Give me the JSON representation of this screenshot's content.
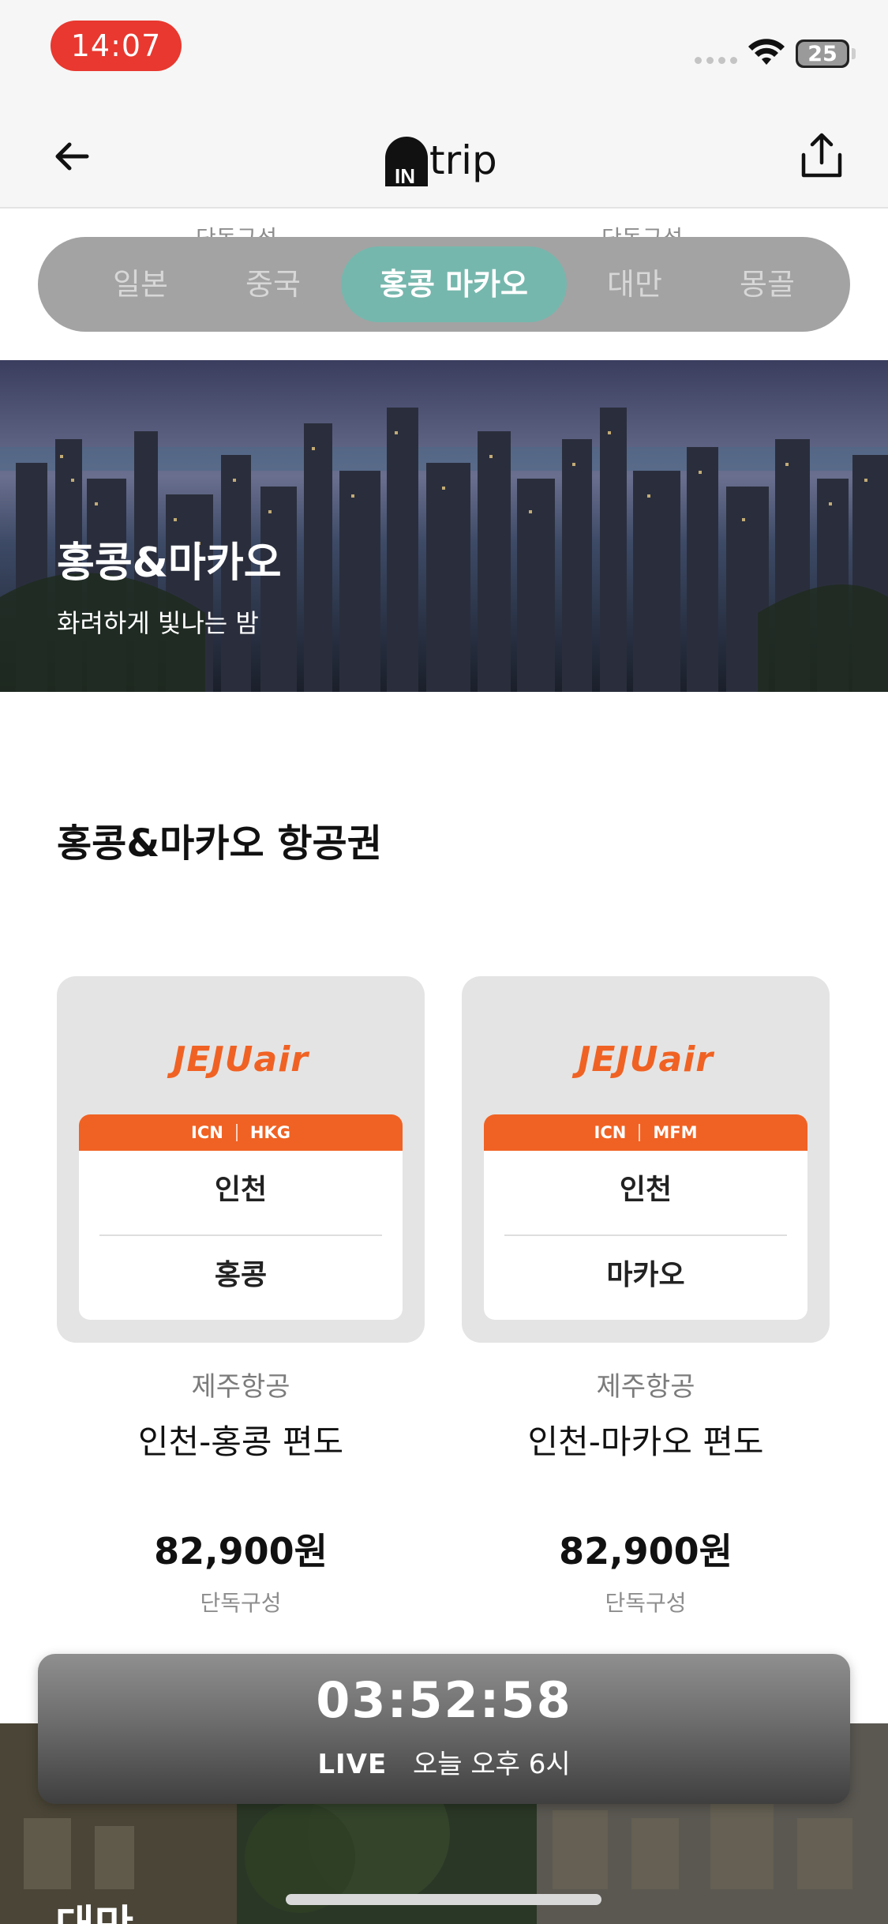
{
  "status_bar": {
    "time": "14:07",
    "battery": "25"
  },
  "header": {
    "logo_mark": "IN",
    "logo_text": "trip"
  },
  "peek_text": [
    "단독구성",
    "단독구성"
  ],
  "tabs": [
    {
      "label": "일본"
    },
    {
      "label": "중국"
    },
    {
      "label": "홍콩 마카오",
      "active": true
    },
    {
      "label": "대만"
    },
    {
      "label": "몽골"
    }
  ],
  "hero": {
    "title": "홍콩&마카오",
    "subtitle": "화려하게 빛나는 밤"
  },
  "section": {
    "title": "홍콩&마카오 항공권"
  },
  "cards": [
    {
      "airline_logo": "JEJUair",
      "from_code": "ICN",
      "to_code": "HKG",
      "from_city": "인천",
      "to_city": "홍콩",
      "airline": "제주항공",
      "route": "인천-홍콩 편도",
      "price": "82,900원",
      "note": "단독구성"
    },
    {
      "airline_logo": "JEJUair",
      "from_code": "ICN",
      "to_code": "MFM",
      "from_city": "인천",
      "to_city": "마카오",
      "airline": "제주항공",
      "route": "인천-마카오 편도",
      "price": "82,900원",
      "note": "단독구성"
    }
  ],
  "countdown": {
    "timer": "03:52:58",
    "live_label": "LIVE",
    "live_time": "오늘 오후 6시"
  },
  "next_section": {
    "title": "대만"
  },
  "colors": {
    "accent": "#f06223",
    "tab_active": "#76b7ad",
    "time_pill": "#e8382f"
  }
}
